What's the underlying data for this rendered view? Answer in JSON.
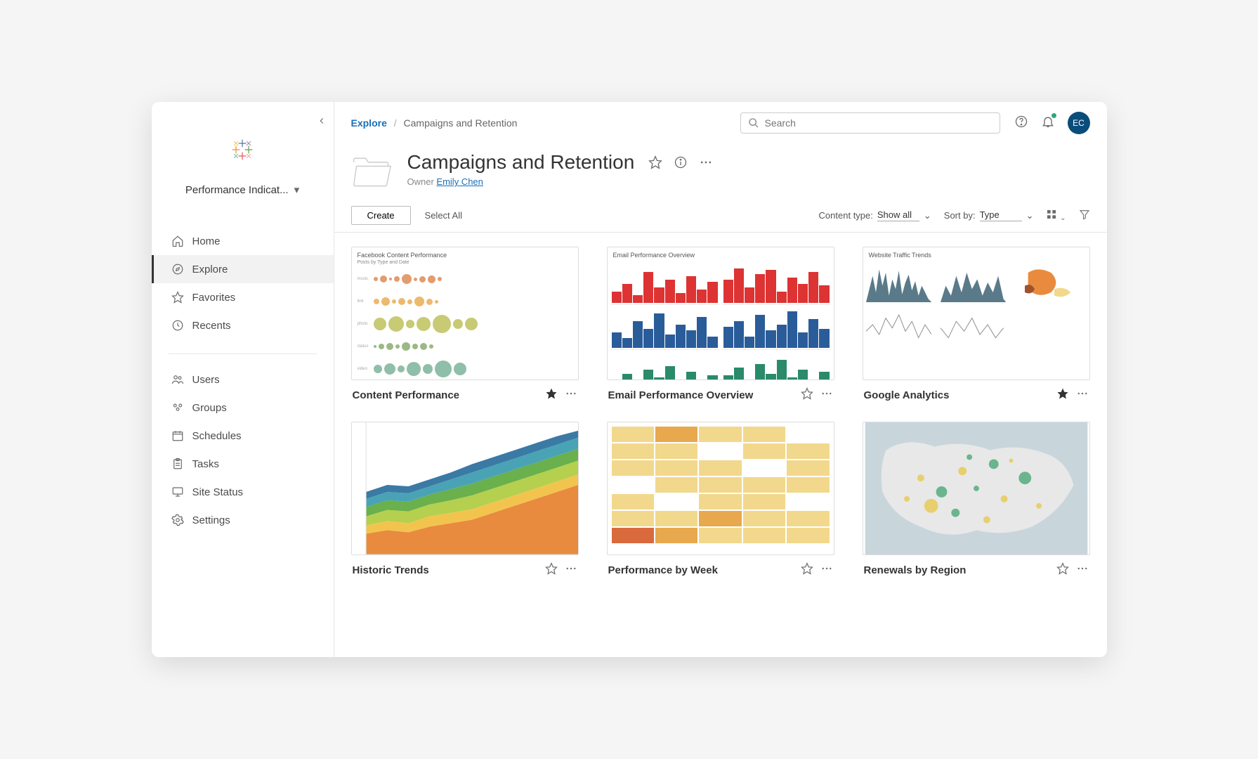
{
  "sidebar": {
    "site_selector": "Performance Indicat...",
    "nav_primary": [
      {
        "icon": "home",
        "label": "Home",
        "active": false
      },
      {
        "icon": "compass",
        "label": "Explore",
        "active": true
      },
      {
        "icon": "star",
        "label": "Favorites",
        "active": false
      },
      {
        "icon": "clock",
        "label": "Recents",
        "active": false
      }
    ],
    "nav_secondary": [
      {
        "icon": "users",
        "label": "Users"
      },
      {
        "icon": "groups",
        "label": "Groups"
      },
      {
        "icon": "calendar",
        "label": "Schedules"
      },
      {
        "icon": "clipboard",
        "label": "Tasks"
      },
      {
        "icon": "monitor",
        "label": "Site Status"
      },
      {
        "icon": "gear",
        "label": "Settings"
      }
    ]
  },
  "breadcrumb": {
    "root": "Explore",
    "current": "Campaigns and Retention"
  },
  "search": {
    "placeholder": "Search"
  },
  "avatar_initials": "EC",
  "page": {
    "title": "Campaigns and Retention",
    "owner_label": "Owner",
    "owner_name": "Emily Chen"
  },
  "toolbar": {
    "create_label": "Create",
    "select_all_label": "Select All",
    "content_type_label": "Content type:",
    "content_type_value": "Show all",
    "sort_by_label": "Sort by:",
    "sort_by_value": "Type"
  },
  "cards": [
    {
      "title": "Content Performance",
      "starred": true,
      "thumb_title": "Facebook Content Performance",
      "thumb_sub": "Posts by Type and Date"
    },
    {
      "title": "Email Performance Overview",
      "starred": false,
      "thumb_title": "Email Performance Overview",
      "thumb_sub": ""
    },
    {
      "title": "Google Analytics",
      "starred": true,
      "thumb_title": "Website Traffic Trends",
      "thumb_sub": ""
    },
    {
      "title": "Historic Trends",
      "starred": false,
      "thumb_title": "",
      "thumb_sub": ""
    },
    {
      "title": "Performance by Week",
      "starred": false,
      "thumb_title": "",
      "thumb_sub": ""
    },
    {
      "title": "Renewals by Region",
      "starred": false,
      "thumb_title": "",
      "thumb_sub": ""
    }
  ]
}
